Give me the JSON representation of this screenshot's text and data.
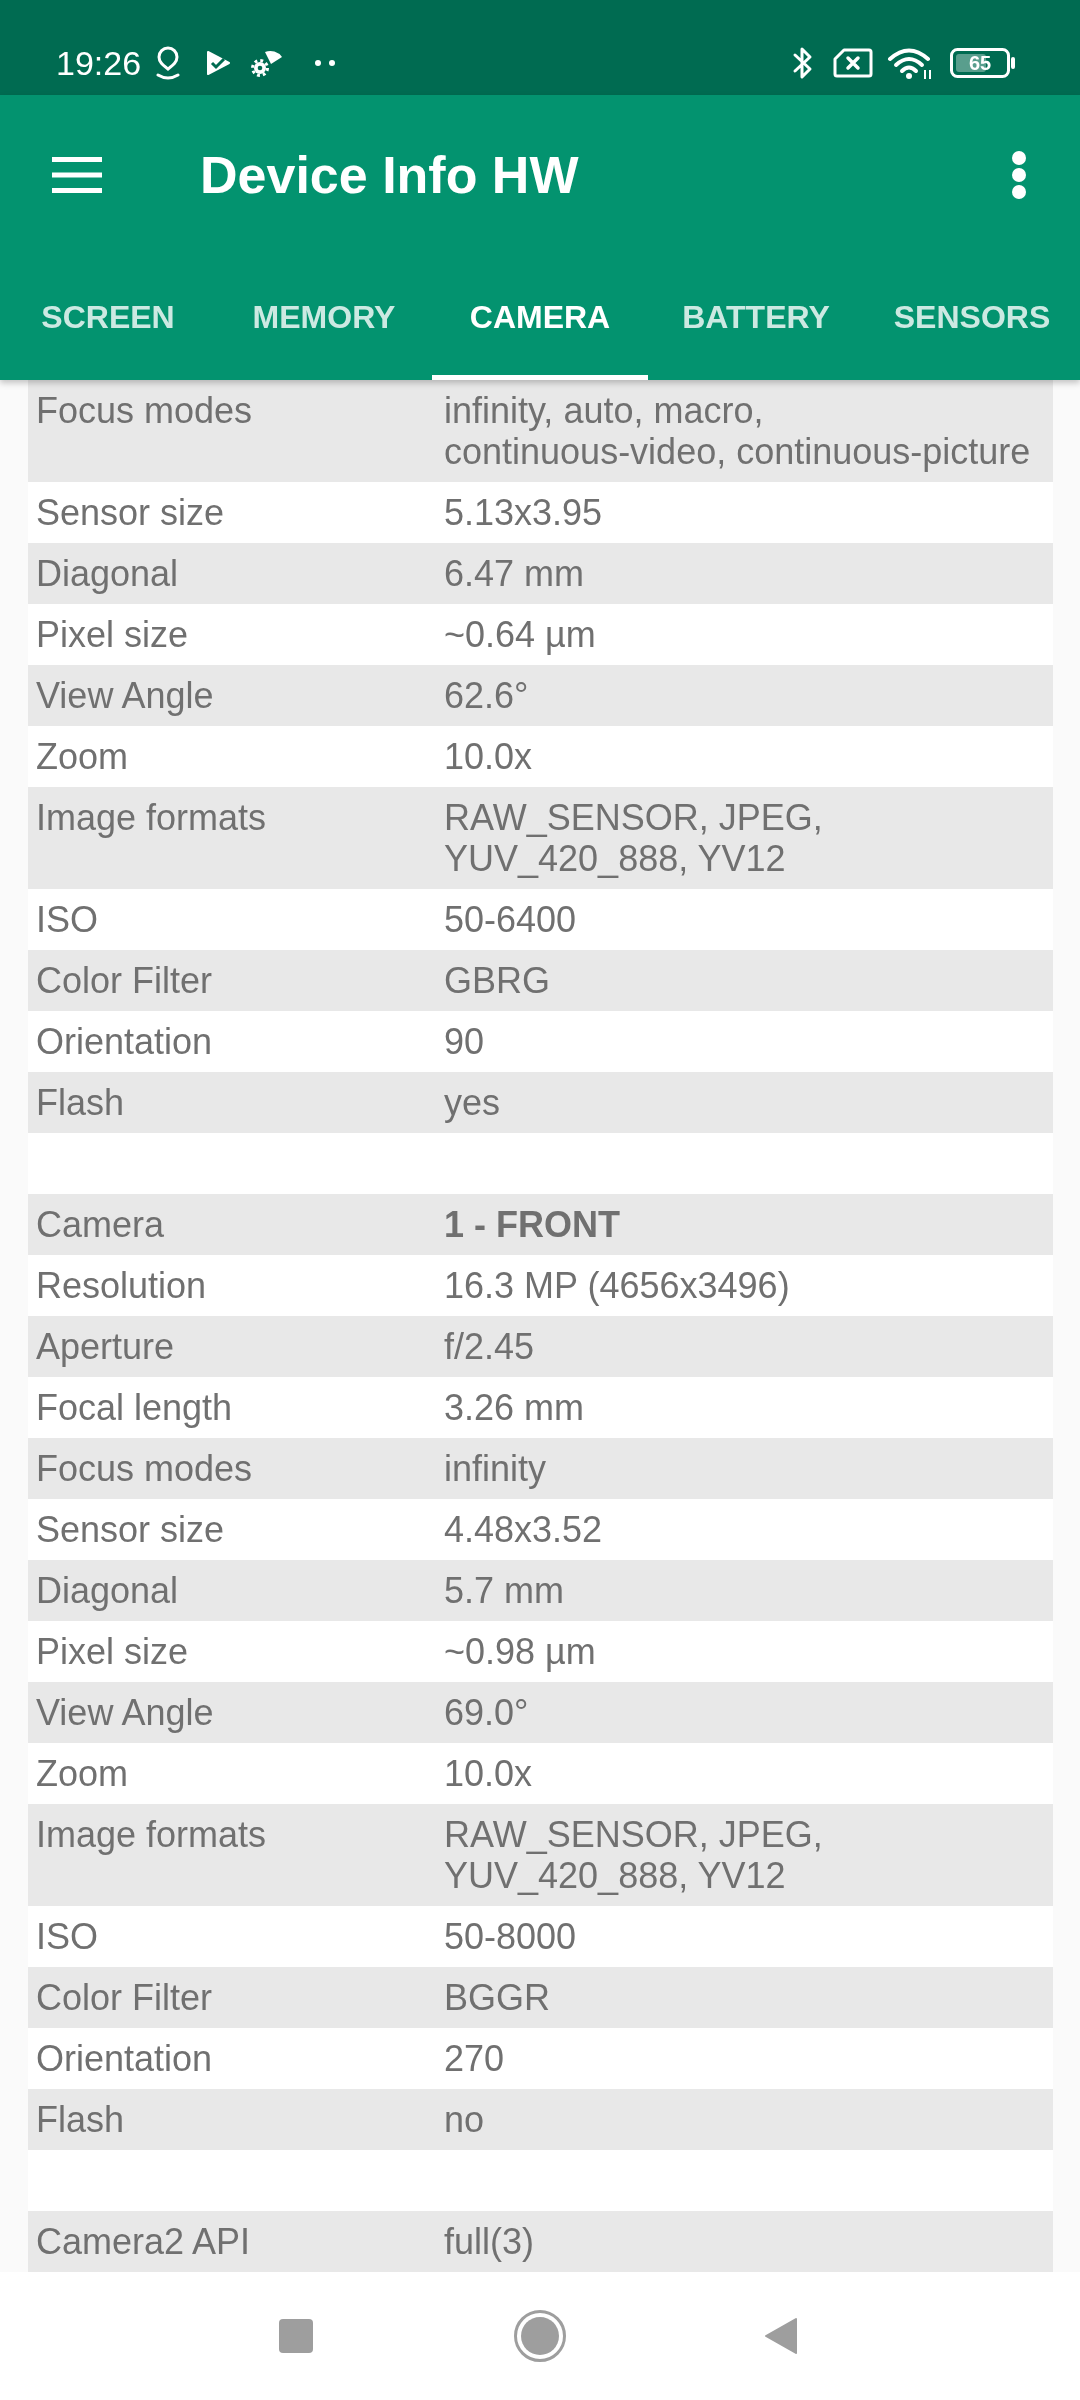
{
  "status_bar": {
    "time": "19:26",
    "battery": "65"
  },
  "app_bar": {
    "title": "Device Info HW"
  },
  "tabs": [
    {
      "label": "SCREEN",
      "selected": false
    },
    {
      "label": "MEMORY",
      "selected": false
    },
    {
      "label": "CAMERA",
      "selected": true
    },
    {
      "label": "BATTERY",
      "selected": false
    },
    {
      "label": "SENSORS",
      "selected": false
    }
  ],
  "sections": [
    {
      "rows": [
        {
          "kind": "property",
          "label": "Focus modes",
          "value": "infinity, auto, macro, continuous-video, continuous-picture"
        },
        {
          "kind": "property",
          "label": "Sensor size",
          "value": "5.13x3.95"
        },
        {
          "kind": "property",
          "label": "Diagonal",
          "value": "6.47 mm"
        },
        {
          "kind": "property",
          "label": "Pixel size",
          "value": "~0.64 µm"
        },
        {
          "kind": "property",
          "label": "View Angle",
          "value": "62.6°"
        },
        {
          "kind": "property",
          "label": "Zoom",
          "value": "10.0x"
        },
        {
          "kind": "property",
          "label": "Image formats",
          "value": "RAW_SENSOR, JPEG, YUV_420_888, YV12"
        },
        {
          "kind": "property",
          "label": "ISO",
          "value": "50-6400"
        },
        {
          "kind": "property",
          "label": "Color Filter",
          "value": "GBRG"
        },
        {
          "kind": "property",
          "label": "Orientation",
          "value": "90"
        },
        {
          "kind": "property",
          "label": "Flash",
          "value": "yes"
        }
      ]
    },
    {
      "rows": [
        {
          "kind": "header",
          "label": "Camera",
          "value": "1 - FRONT"
        },
        {
          "kind": "property",
          "label": "Resolution",
          "value": "16.3 MP (4656x3496)"
        },
        {
          "kind": "property",
          "label": "Aperture",
          "value": "f/2.45"
        },
        {
          "kind": "property",
          "label": "Focal length",
          "value": "3.26 mm"
        },
        {
          "kind": "property",
          "label": "Focus modes",
          "value": "infinity"
        },
        {
          "kind": "property",
          "label": "Sensor size",
          "value": "4.48x3.52"
        },
        {
          "kind": "property",
          "label": "Diagonal",
          "value": "5.7 mm"
        },
        {
          "kind": "property",
          "label": "Pixel size",
          "value": "~0.98 µm"
        },
        {
          "kind": "property",
          "label": "View Angle",
          "value": "69.0°"
        },
        {
          "kind": "property",
          "label": "Zoom",
          "value": "10.0x"
        },
        {
          "kind": "property",
          "label": "Image formats",
          "value": "RAW_SENSOR, JPEG, YUV_420_888, YV12"
        },
        {
          "kind": "property",
          "label": "ISO",
          "value": "50-8000"
        },
        {
          "kind": "property",
          "label": "Color Filter",
          "value": "BGGR"
        },
        {
          "kind": "property",
          "label": "Orientation",
          "value": "270"
        },
        {
          "kind": "property",
          "label": "Flash",
          "value": "no"
        }
      ]
    },
    {
      "rows": [
        {
          "kind": "property",
          "label": "Camera2 API",
          "value": "full(3)"
        }
      ]
    }
  ]
}
